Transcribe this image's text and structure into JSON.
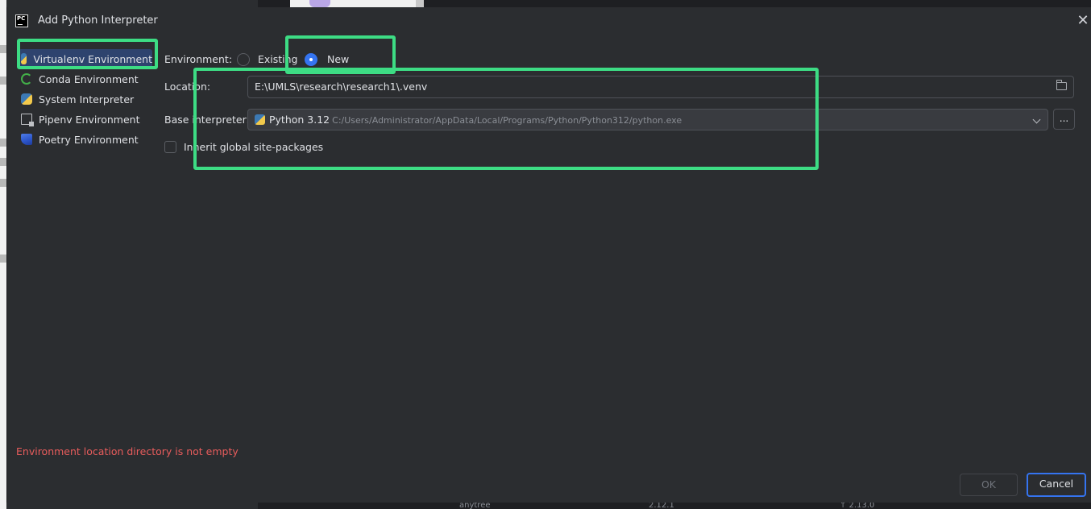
{
  "window": {
    "title": "Add Python Interpreter",
    "app_icon_text": "PC"
  },
  "sidebar": {
    "items": [
      {
        "label": "Virtualenv Environment",
        "icon": "virtualenv-icon",
        "selected": true
      },
      {
        "label": "Conda Environment",
        "icon": "conda-icon",
        "selected": false
      },
      {
        "label": "System Interpreter",
        "icon": "python-icon",
        "selected": false
      },
      {
        "label": "Pipenv Environment",
        "icon": "pipenv-icon",
        "selected": false
      },
      {
        "label": "Poetry Environment",
        "icon": "poetry-icon",
        "selected": false
      }
    ]
  },
  "form": {
    "environment_label": "Environment:",
    "environment_options": [
      {
        "label": "Existing",
        "selected": false
      },
      {
        "label": "New",
        "selected": true
      }
    ],
    "location_label": "Location:",
    "location_value": "E:\\UMLS\\research\\research1\\.venv",
    "base_interpreter_label": "Base interpreter:",
    "base_interpreter_name": "Python 3.12",
    "base_interpreter_path": "C:/Users/Administrator/AppData/Local/Programs/Python/Python312/python.exe",
    "browse_label": "...",
    "inherit_label": "Inherit global site-packages",
    "inherit_checked": false
  },
  "error_message": "Environment location directory is not empty",
  "buttons": {
    "ok_label": "OK",
    "ok_enabled": false,
    "cancel_label": "Cancel"
  },
  "background": {
    "bottom_texts": [
      "anytree",
      "2.12.1",
      "↑ 2.13.0"
    ]
  },
  "colors": {
    "dialog_bg": "#2b2d30",
    "selection_bg": "#2e436e",
    "accent_blue": "#3574f0",
    "error_red": "#e85c5c",
    "annotation_green": "#3ddc84"
  }
}
